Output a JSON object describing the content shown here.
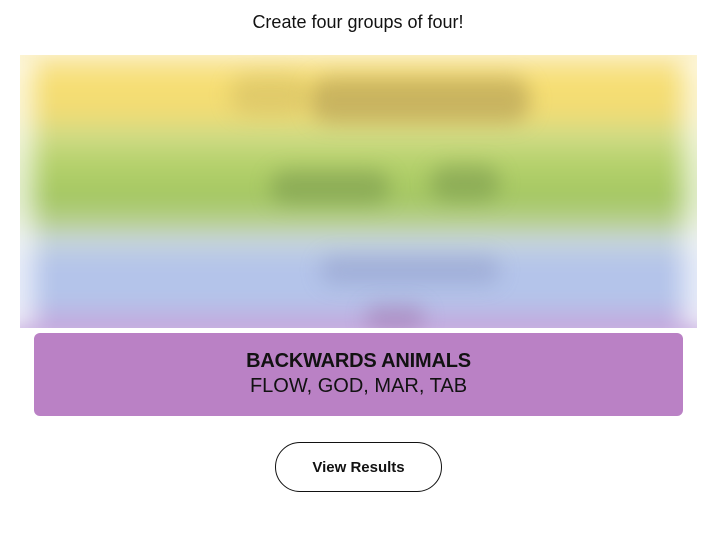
{
  "game": {
    "instructions": "Create four groups of four!"
  },
  "board": {
    "blurred_band_colors": [
      "#f7de71",
      "#a4c762",
      "#b4c4ea",
      "#ba81c5"
    ]
  },
  "solved_groups": [
    {
      "title": "BACKWARDS ANIMALS",
      "words": "FLOW, GOD, MAR, TAB",
      "color": "#ba81c5"
    }
  ],
  "actions": {
    "view_results_label": "View Results"
  }
}
